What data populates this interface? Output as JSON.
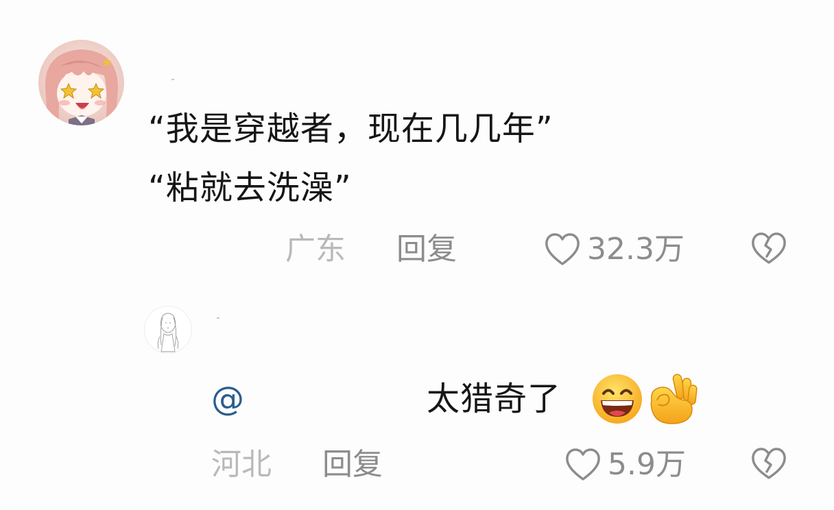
{
  "comment": {
    "lines": [
      "“我是穿越者，现在几几年”",
      "“粘就去洗澡”"
    ],
    "location": "广东",
    "reply_label": "回复",
    "likes": "32.3万"
  },
  "reply": {
    "mention": "@",
    "text": "太猎奇了",
    "emojis": [
      "grinning-face-emoji",
      "ok-hand-emoji"
    ],
    "location": "河北",
    "reply_label": "回复",
    "likes": "5.9万"
  },
  "icons": {
    "like": "heart-outline-icon",
    "dislike": "broken-heart-icon"
  },
  "colors": {
    "background": "#fdfdfd",
    "text": "#161616",
    "muted": "#8c8c8c",
    "location": "#b9b9b9",
    "mention": "#2c5d8f"
  }
}
